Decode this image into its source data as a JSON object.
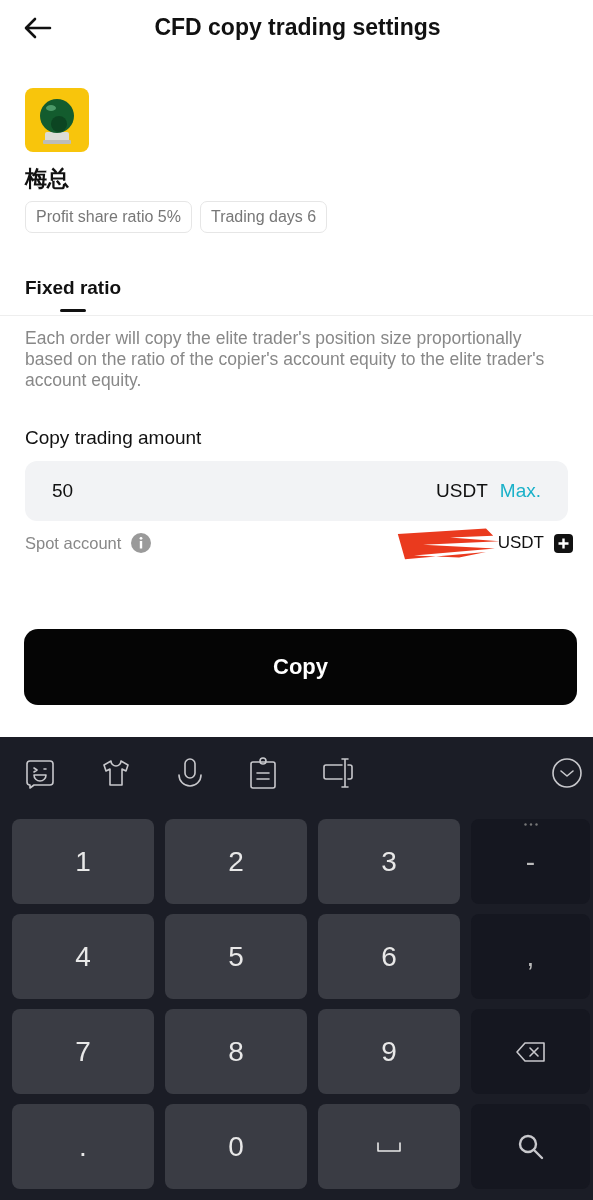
{
  "header": {
    "title": "CFD copy trading settings"
  },
  "trader": {
    "name": "梅总",
    "tags": [
      "Profit share ratio 5%",
      "Trading days 6"
    ]
  },
  "tabs": [
    {
      "label": "Fixed ratio",
      "selected": true
    }
  ],
  "description": "Each order will copy the elite trader's position size proportionally based on the ratio of the copier's account equity to the elite trader's account equity.",
  "amount": {
    "label": "Copy trading amount",
    "value": "50",
    "unit": "USDT",
    "max": "Max."
  },
  "spot_account": {
    "label": "Spot account",
    "value": "USDT",
    "redacted": true
  },
  "copy_button": "Copy",
  "keyboard": {
    "rows": [
      [
        {
          "kind": "char",
          "label": "1"
        },
        {
          "kind": "char",
          "label": "2"
        },
        {
          "kind": "char",
          "label": "3"
        },
        {
          "kind": "char",
          "label": "-",
          "side": true
        }
      ],
      [
        {
          "kind": "char",
          "label": "4"
        },
        {
          "kind": "char",
          "label": "5"
        },
        {
          "kind": "char",
          "label": "6"
        },
        {
          "kind": "char",
          "label": ",",
          "side": true
        }
      ],
      [
        {
          "kind": "char",
          "label": "7"
        },
        {
          "kind": "char",
          "label": "8"
        },
        {
          "kind": "char",
          "label": "9"
        },
        {
          "kind": "backspace",
          "side": true
        }
      ],
      [
        {
          "kind": "char",
          "label": "."
        },
        {
          "kind": "char",
          "label": "0"
        },
        {
          "kind": "space"
        },
        {
          "kind": "search",
          "side": true
        }
      ]
    ]
  }
}
